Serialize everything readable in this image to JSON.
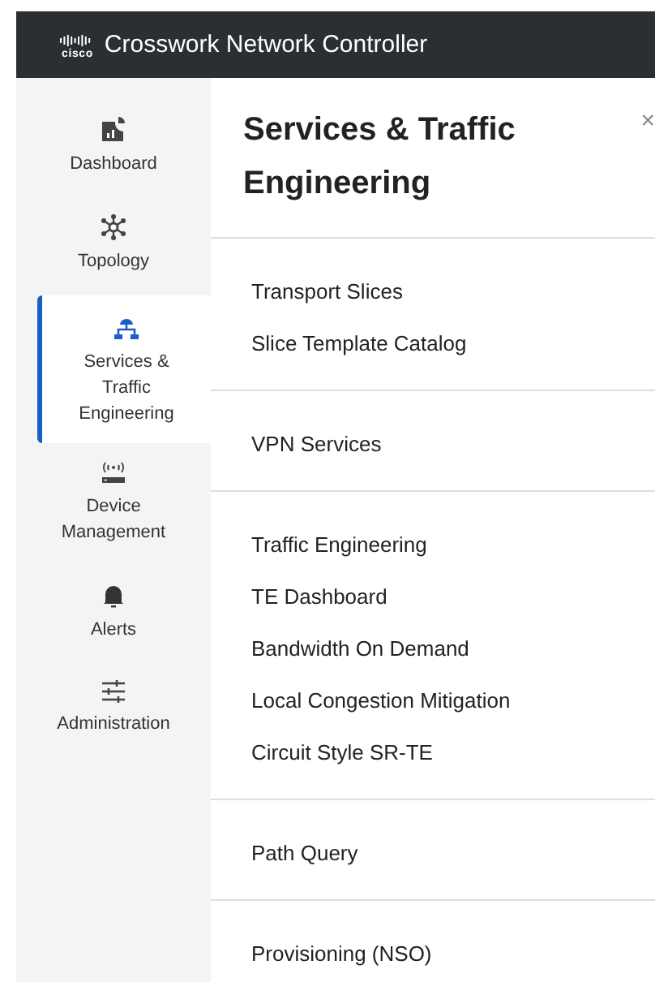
{
  "header": {
    "logo_text": "cisco",
    "title": "Crosswork Network Controller"
  },
  "sidebar": {
    "items": [
      {
        "label": "Dashboard",
        "selected": false
      },
      {
        "label": "Topology",
        "selected": false
      },
      {
        "label": "Services & Traffic Engineering",
        "selected": true
      },
      {
        "label": "Device Management",
        "selected": false
      },
      {
        "label": "Alerts",
        "selected": false
      },
      {
        "label": "Administration",
        "selected": false
      }
    ]
  },
  "panel": {
    "title": "Services & Traffic Engineering",
    "close": "×",
    "sections": [
      {
        "items": [
          "Transport Slices",
          "Slice Template Catalog"
        ]
      },
      {
        "items": [
          "VPN Services"
        ]
      },
      {
        "items": [
          "Traffic Engineering",
          "TE Dashboard",
          "Bandwidth On Demand",
          "Local Congestion Mitigation",
          "Circuit Style SR-TE"
        ]
      },
      {
        "items": [
          "Path Query"
        ]
      },
      {
        "items": [
          "Provisioning (NSO)"
        ]
      }
    ]
  }
}
